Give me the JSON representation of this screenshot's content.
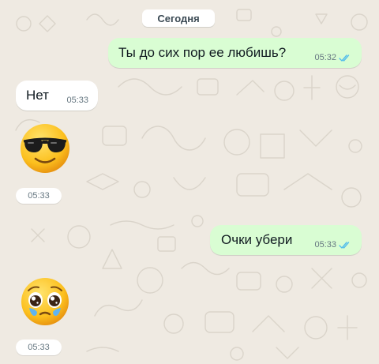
{
  "chat": {
    "date_label": "Сегодня",
    "messages": [
      {
        "direction": "outgoing",
        "type": "text",
        "text": "Ты до сих пор ее любишь?",
        "time": "05:32",
        "status": "read"
      },
      {
        "direction": "incoming",
        "type": "text",
        "text": "Нет",
        "time": "05:33"
      },
      {
        "direction": "incoming",
        "type": "emoji",
        "emoji": "smiling-face-with-sunglasses",
        "time": "05:33"
      },
      {
        "direction": "outgoing",
        "type": "text",
        "text": "Очки убери",
        "time": "05:33",
        "status": "read"
      },
      {
        "direction": "incoming",
        "type": "emoji",
        "emoji": "pleading-face-with-tears",
        "time": "05:33"
      }
    ]
  },
  "colors": {
    "background": "#efeae2",
    "outgoing_bubble": "#d9fdd3",
    "incoming_bubble": "#ffffff",
    "read_ticks": "#53bdeb"
  }
}
